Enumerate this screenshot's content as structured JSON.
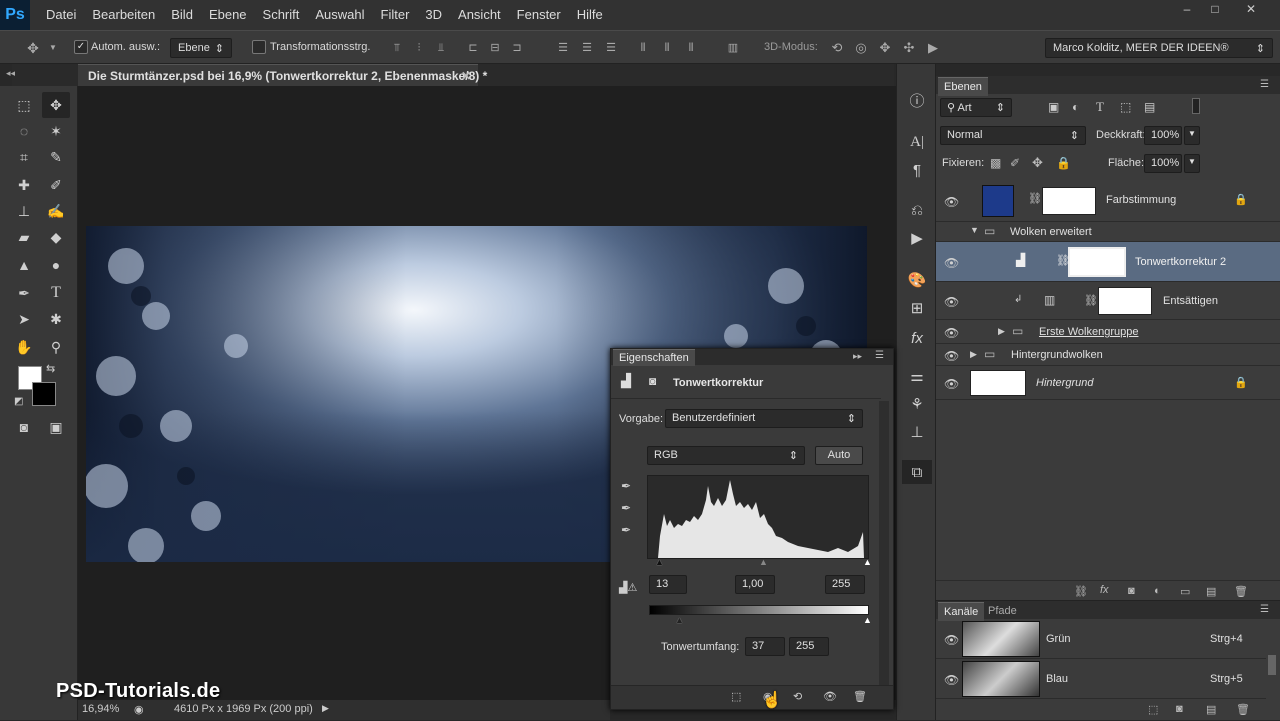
{
  "app": {
    "logo": "Ps"
  },
  "menu": [
    "Datei",
    "Bearbeiten",
    "Bild",
    "Ebene",
    "Schrift",
    "Auswahl",
    "Filter",
    "3D",
    "Ansicht",
    "Fenster",
    "Hilfe"
  ],
  "window_controls": {
    "minimize": "–",
    "maximize": "□",
    "close": "✕"
  },
  "options": {
    "auto_select_label": "Autom. ausw.:",
    "auto_select_checked": true,
    "auto_select_value": "Ebene",
    "transform_label": "Transformationsstrg.",
    "mode_3d_label": "3D-Modus:",
    "workspace": "Marco Kolditz, MEER DER IDEEN®"
  },
  "document": {
    "tab_title": "Die Sturmtänzer.psd bei 16,9% (Tonwertkorrektur 2, Ebenenmaske/8) *",
    "zoom": "16,94%",
    "doc_info": "4610 Px x 1969 Px (200 ppi)"
  },
  "watermark": "PSD-Tutorials.de",
  "layers_panel": {
    "tab": "Ebenen",
    "filter_kind": "Art",
    "blend_mode": "Normal",
    "opacity_label": "Deckkraft:",
    "opacity_value": "100%",
    "lock_label": "Fixieren:",
    "fill_label": "Fläche:",
    "fill_value": "100%",
    "layers": [
      {
        "name": "Farbstimmung"
      },
      {
        "name": "Wolken erweitert"
      },
      {
        "name": "Tonwertkorrektur 2"
      },
      {
        "name": "Entsättigen"
      },
      {
        "name": "Erste Wolkengruppe"
      },
      {
        "name": "Hintergrundwolken"
      },
      {
        "name": "Hintergrund"
      }
    ]
  },
  "properties": {
    "title": "Eigenschaften",
    "subtitle": "Tonwertkorrektur",
    "preset_label": "Vorgabe:",
    "preset_value": "Benutzerdefiniert",
    "channel": "RGB",
    "auto_button": "Auto",
    "input_black": "13",
    "input_gamma": "1,00",
    "input_white": "255",
    "output_label": "Tonwertumfang:",
    "output_black": "37",
    "output_white": "255"
  },
  "channels_panel": {
    "tabs": [
      "Kanäle",
      "Pfade"
    ],
    "channels": [
      {
        "name": "Grün",
        "shortcut": "Strg+4"
      },
      {
        "name": "Blau",
        "shortcut": "Strg+5"
      }
    ]
  }
}
